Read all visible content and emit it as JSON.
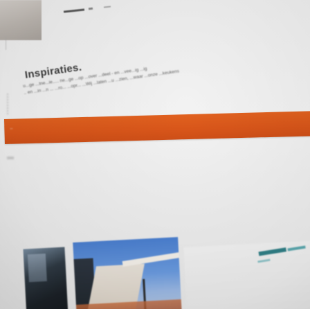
{
  "header": {
    "logo_text": "",
    "top_nav_hint": ""
  },
  "content": {
    "heading": "Inspiraties.",
    "paragraph_lines": [
      "u...ge ...tne...ie..... ne...ge ...op ...over ...deel - en ...vee...ig ...ig",
      ".. en ...in ...n ... ...ro... ...opr... ...Wij ...laten ...u ...zien, ...waar ...onze ...keukens"
    ]
  },
  "navbar": {
    "color": "#d9561a",
    "items": [
      "",
      "",
      "",
      "",
      ""
    ]
  },
  "thumbnails": {
    "count": 3
  }
}
